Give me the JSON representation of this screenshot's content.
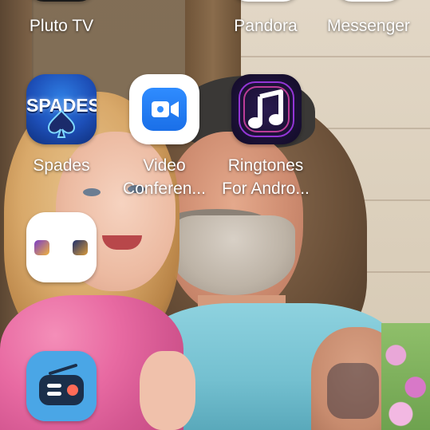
{
  "home_screen": {
    "top_row_labels": [
      "Pluto TV",
      "Pandora",
      "Messenger"
    ],
    "apps": [
      {
        "label": "Spades",
        "icon": "spades-app-icon",
        "icon_text": "SPADES"
      },
      {
        "label": "Video\nConferen...",
        "line1": "Video",
        "line2": "Conferen...",
        "icon": "video-camera-icon"
      },
      {
        "label": "Ringtones\nFor Andro...",
        "line1": "Ringtones",
        "line2": "For Andro...",
        "icon": "music-note-icon"
      },
      {
        "label": "",
        "icon": "app-folder-icon"
      },
      {
        "label": "",
        "icon": "radio-app-icon"
      }
    ]
  },
  "colors": {
    "spades_blue": "#1d4fb8",
    "video_blue": "#1a6fe8",
    "ringtones_bg": "#1b1136",
    "radio_blue": "#4aa6e6",
    "label_text": "#ffffff"
  }
}
